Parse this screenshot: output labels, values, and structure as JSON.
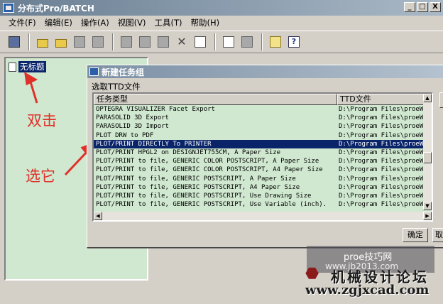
{
  "window": {
    "title": "分布式Pro/BATCH",
    "buttons": {
      "minimize": "_",
      "maximize": "□",
      "close": "X"
    }
  },
  "menu": [
    "文件(F)",
    "编辑(E)",
    "操作(A)",
    "视图(V)",
    "工具(T)",
    "帮助(H)"
  ],
  "toolbar": {
    "icons": [
      "new-doc-icon",
      "open-folder-icon",
      "open-folder2-icon",
      "save-icon",
      "save-all-icon",
      "cut-icon",
      "copy-icon",
      "paste-icon",
      "delete-icon",
      "properties-icon",
      "report-icon",
      "gear-icon",
      "notes-icon",
      "help-icon"
    ],
    "delete_glyph": "✕",
    "help_glyph": "?"
  },
  "tree": {
    "item_label": "无标题"
  },
  "annotations": {
    "double_click": "双击",
    "select_it": "选它"
  },
  "dialog": {
    "title": "新建任务组",
    "subtitle": "选取TTD文件",
    "columns": [
      "任务类型",
      "TTD文件"
    ],
    "rows": [
      {
        "type": "OPTEGRA VISUALIZER Facet Export",
        "file": "D:\\Program Files\\proeWi"
      },
      {
        "type": "PARASOLID 3D  Export",
        "file": "D:\\Program Files\\proeWi"
      },
      {
        "type": "PARASOLID 3D Import",
        "file": "D:\\Program Files\\proeWi"
      },
      {
        "type": "PLOT DRW to PDF",
        "file": "D:\\Program Files\\proeWi"
      },
      {
        "type": "PLOT/PRINT DIRECTLY To PRINTER",
        "file": "D:\\Program Files\\proeWi",
        "selected": true
      },
      {
        "type": "PLOT/PRINT HPGL2 on DESIGNJET755CM, A Paper Size",
        "file": "D:\\Program Files\\proeWi"
      },
      {
        "type": "PLOT/PRINT to file, GENERIC COLOR POSTSCRIPT, A Paper Size",
        "file": "D:\\Program Files\\proeWi"
      },
      {
        "type": "PLOT/PRINT to file, GENERIC COLOR POSTSCRIPT, A4 Paper Size",
        "file": "D:\\Program Files\\proeWi"
      },
      {
        "type": "PLOT/PRINT to file, GENERIC POSTSCRIPT, A Paper Size",
        "file": "D:\\Program Files\\proeWi"
      },
      {
        "type": "PLOT/PRINT to file, GENERIC POSTSCRIPT, A4 Paper Size",
        "file": "D:\\Program Files\\proeWi"
      },
      {
        "type": "PLOT/PRINT to file, GENERIC POSTSCRIPT, Use Drawing Size",
        "file": "D:\\Program Files\\proeWi"
      },
      {
        "type": "PLOT/PRINT to file, GENERIC POSTSCRIPT, Use Variable (inch).",
        "file": "D:\\Program Files\\proeWi"
      }
    ],
    "ok_label": "确定",
    "cancel_label": "取"
  },
  "watermark": {
    "line1": "proe技巧网",
    "line2": "www.jb2013.com",
    "line3": "机械设计论坛",
    "line4": "www.zgjxcad.com"
  },
  "colors": {
    "selection": "#0a246a",
    "list_bg": "#cfe8cf",
    "annotation": "#e0302a"
  }
}
